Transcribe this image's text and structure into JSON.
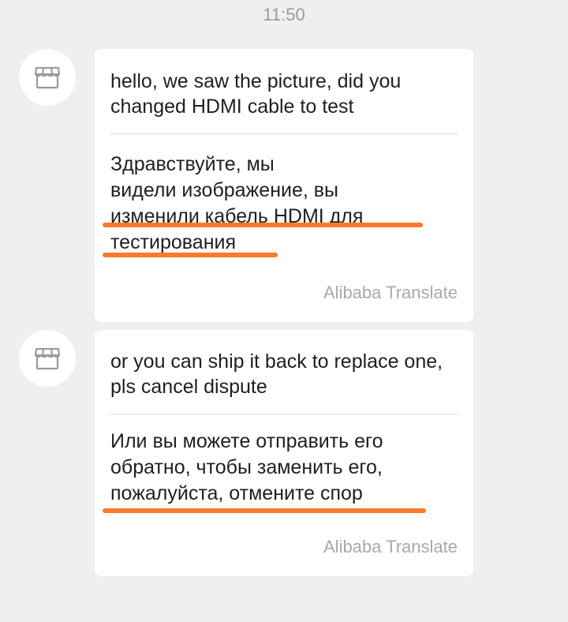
{
  "status": {
    "time": "11:50"
  },
  "colors": {
    "background": "#efefef",
    "bubble": "#ffffff",
    "annotation": "#fb7a2a"
  },
  "messages": [
    {
      "avatar_icon": "store-icon",
      "original": "hello, we saw the picture, did you changed HDMI cable to test",
      "translated_lines": [
        "Здравствуйте, мы",
        "видели изображение, вы",
        "изменили кабель HDMI для",
        "тестирования"
      ],
      "attribution": "Alibaba Translate"
    },
    {
      "avatar_icon": "store-icon",
      "original": "or you can ship it back to replace one, pls cancel dispute",
      "translated_lines": [
        "Или вы можете отправить его",
        "обратно, чтобы заменить его,",
        "пожалуйста, отмените спор"
      ],
      "attribution": "Alibaba Translate"
    }
  ]
}
